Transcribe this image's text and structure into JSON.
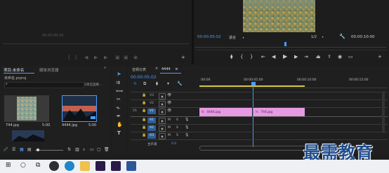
{
  "source_monitor": {
    "center_label": "00:00:00:00"
  },
  "program_monitor": {
    "timecode_left": "00:00:05:02",
    "fit_select": "适合",
    "ratio": "1/2",
    "timecode_right": "00:00:10:00"
  },
  "project_panel": {
    "tab_project": "项目:未命名",
    "tab_media_browser": "媒体浏览器",
    "file_name": "未命名.prproj",
    "selection_info": "1项已选择...",
    "items": [
      {
        "name": "744.jpg",
        "duration": "5:00"
      },
      {
        "name": "4444.jpg",
        "duration": "5:00"
      }
    ]
  },
  "timeline": {
    "tab_close": "×",
    "sequence_label": "4444",
    "tab_title": "音频仪表",
    "timecode": "00:00:05:02",
    "ruler": [
      ":00:00",
      "00:00:05:00",
      "00:00:10:00",
      "00:00:15:00"
    ],
    "tracks": {
      "video": [
        "V3",
        "V2",
        "V1"
      ],
      "audio": [
        "A1",
        "A2",
        "A3"
      ],
      "master": "主声道",
      "master_value": "0.0"
    },
    "clips": [
      {
        "label": "4444.jpg"
      },
      {
        "label": "744.jpg"
      }
    ]
  },
  "watermark": {
    "text": "最需教育"
  },
  "colors": {
    "accent": "#4a9eff",
    "clip_pink": "#e59ae1",
    "playhead": "#4a9eff",
    "track_blue": "#2e5f95"
  }
}
